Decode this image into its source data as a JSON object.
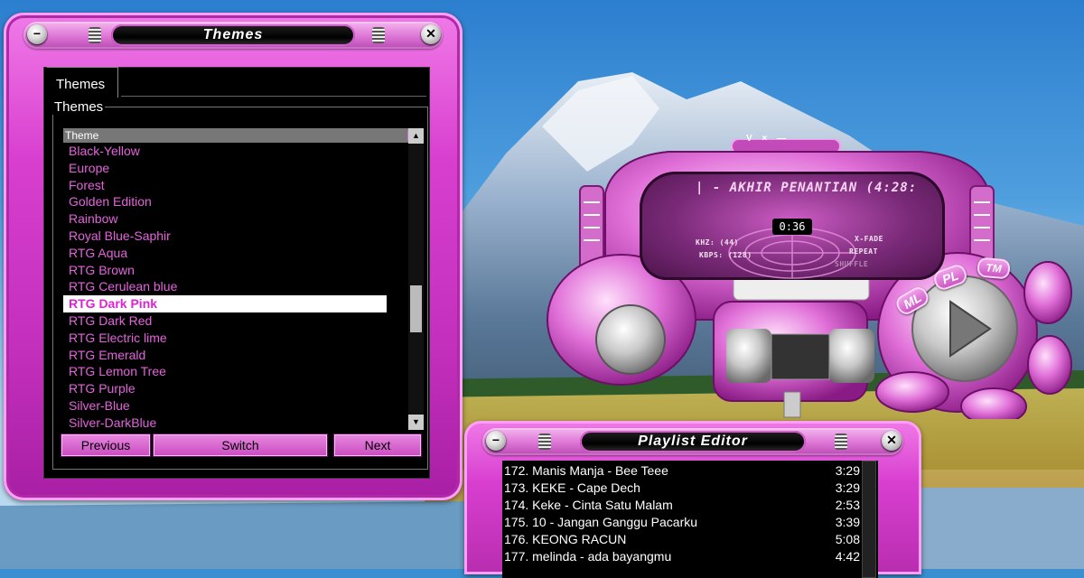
{
  "themes_window": {
    "title": "Themes",
    "tab_label": "Themes",
    "group_label": "Themes",
    "list_header": "Theme",
    "items": [
      "Black-Yellow",
      "Europe",
      "Forest",
      "Golden Edition",
      "Rainbow",
      "Royal Blue-Saphir",
      "RTG Aqua",
      "RTG Brown",
      "RTG Cerulean blue",
      "RTG Dark Pink",
      "RTG Dark Red",
      "RTG Electric lime",
      "RTG Emerald",
      "RTG Lemon Tree",
      "RTG Purple",
      "Silver-Blue",
      "Silver-DarkBlue"
    ],
    "selected_item": "RTG Dark Pink",
    "buttons": {
      "previous": "Previous",
      "switch": "Switch",
      "next": "Next"
    },
    "minimize_symbol": "−",
    "close_symbol": "✕"
  },
  "player": {
    "song_title": "| - AKHIR PENANTIAN (4:28:",
    "elapsed_time": "0:36",
    "khz_label": "KHZ:",
    "khz_value": "(44)",
    "kbps_label": "KBPS:",
    "kbps_value": "(128)",
    "xfade": "X-FADE",
    "repeat": "REPEAT",
    "shuffle": "SHUFFLE",
    "ml_button": "ML",
    "pl_button": "PL",
    "tm_button": "TM",
    "top_symbols": "V × —"
  },
  "playlist_window": {
    "title": "Playlist Editor",
    "close_symbol": "✕",
    "rows": [
      {
        "title": "172. Manis Manja - Bee Teee",
        "time": "3:29"
      },
      {
        "title": "173. KEKE - Cape Dech",
        "time": "3:29"
      },
      {
        "title": "174. Keke - Cinta Satu Malam",
        "time": "2:53"
      },
      {
        "title": "175. 10 - Jangan Ganggu Pacarku",
        "time": "3:39"
      },
      {
        "title": "176. KEONG RACUN",
        "time": "5:08"
      },
      {
        "title": "177. melinda - ada bayangmu",
        "time": "4:42"
      }
    ]
  },
  "colors": {
    "accent": "#d83fcf",
    "list_text": "#e463dc",
    "selected_bg": "#ffffff"
  }
}
